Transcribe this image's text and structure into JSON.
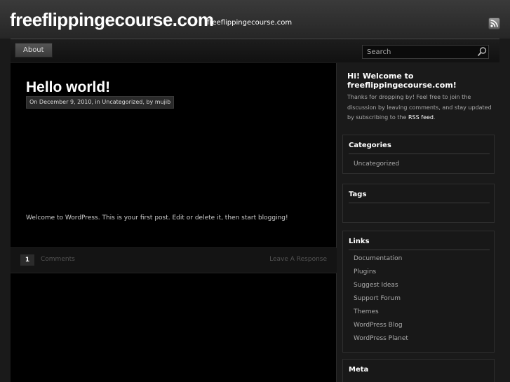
{
  "header": {
    "site_title": "freeflippingecourse.com",
    "site_description": "freeflippingecourse.com",
    "rss_icon": "rss-icon"
  },
  "nav": {
    "items": [
      {
        "label": "About"
      }
    ],
    "search": {
      "placeholder": "Search",
      "icon": "search-icon"
    }
  },
  "post": {
    "title": "Hello world!",
    "meta": "On December 9, 2010, in Uncategorized, by mujib",
    "body": "Welcome to WordPress. This is your first post. Edit or delete it, then start blogging!",
    "comment_count": "1",
    "comments_label": "Comments",
    "leave_response_label": "Leave A Response"
  },
  "sidebar": {
    "welcome": {
      "title": "Hi! Welcome to freeflippingecourse.com!",
      "text_before": "Thanks for dropping by! Feel free to join the discussion by leaving comments, and stay updated by subscribing to the ",
      "rss_link": "RSS feed",
      "text_after": "."
    },
    "categories": {
      "title": "Categories",
      "items": [
        {
          "label": "Uncategorized"
        }
      ]
    },
    "tags": {
      "title": "Tags"
    },
    "links": {
      "title": "Links",
      "items": [
        {
          "label": "Documentation"
        },
        {
          "label": "Plugins"
        },
        {
          "label": "Suggest Ideas"
        },
        {
          "label": "Support Forum"
        },
        {
          "label": "Themes"
        },
        {
          "label": "WordPress Blog"
        },
        {
          "label": "WordPress Planet"
        }
      ]
    },
    "meta": {
      "title": "Meta"
    }
  },
  "colors": {
    "background": "#1a1a1a",
    "content": "#000000",
    "text": "#cccccc",
    "accent": "#ffffff"
  }
}
